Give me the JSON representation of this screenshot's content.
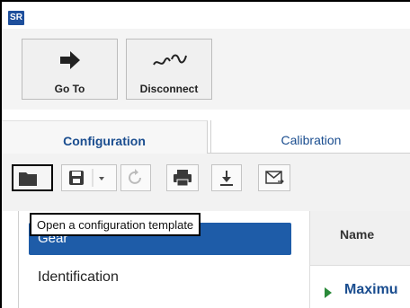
{
  "app": {
    "icon_text": "SR"
  },
  "ribbon": {
    "goto_label": "Go To",
    "disconnect_label": "Disconnect"
  },
  "tabs": [
    {
      "label": "Configuration",
      "active": true
    },
    {
      "label": "Calibration",
      "active": false
    }
  ],
  "toolbar": {
    "buttons": [
      {
        "icon": "folder-icon"
      },
      {
        "icon": "save-icon"
      },
      {
        "icon": "refresh-icon"
      },
      {
        "icon": "print-icon"
      },
      {
        "icon": "download-icon"
      },
      {
        "icon": "mail-icon"
      }
    ]
  },
  "tooltip": {
    "text": "Open a configuration template"
  },
  "sidebar": {
    "selected_label": "Gear",
    "items": [
      {
        "label": "Identification"
      }
    ]
  },
  "table": {
    "header_name": "Name",
    "row_label": "Maximu"
  },
  "colors": {
    "accent": "#1e5ca8",
    "brand": "#1a4d8f",
    "expand_arrow": "#2a8a3a"
  }
}
